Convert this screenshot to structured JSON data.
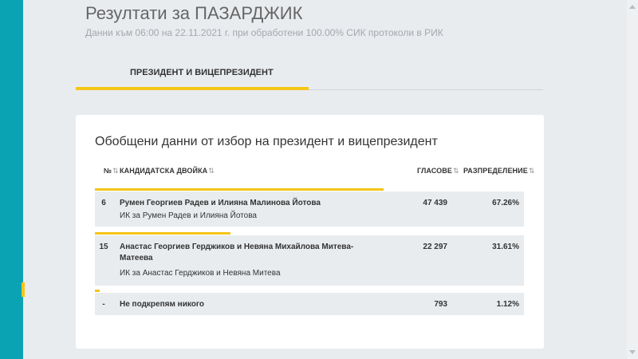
{
  "header": {
    "title": "Резултати за ПАЗАРДЖИК",
    "subtitle": "Данни към 06:00 на 22.11.2021 г. при обработени 100.00% СИК протоколи в РИК"
  },
  "tabs": [
    {
      "label": "ПРЕЗИДЕНТ И ВИЦЕПРЕЗИДЕНТ",
      "active": true
    }
  ],
  "card": {
    "title": "Обобщени данни от избор на президент и вицепрезидент",
    "columns": {
      "number": "№",
      "pair": "КАНДИДАТСКА ДВОЙКА",
      "votes": "ГЛАСОВЕ",
      "share": "РАЗПРЕДЕЛЕНИЕ"
    },
    "rows": [
      {
        "number": "6",
        "name": "Румен Георгиев Радев и Илияна Малинова Йотова",
        "committee": "ИК за Румен Радев и Илияна Йотова",
        "votes": "47 439",
        "share": "67.26%",
        "share_value": 67.26
      },
      {
        "number": "15",
        "name": "Анастас Георгиев Герджиков и Невяна Михайлова Митева-Матеева",
        "committee": "ИК за Анастас Герджиков и Невяна Митева",
        "votes": "22 297",
        "share": "31.61%",
        "share_value": 31.61
      },
      {
        "number": "-",
        "name": "Не подкрепям никого",
        "committee": "",
        "votes": "793",
        "share": "1.12%",
        "share_value": 1.12
      }
    ]
  },
  "colors": {
    "accent_teal": "#0aa3b4",
    "accent_yellow": "#f5c518",
    "background": "#e9ecef"
  },
  "icons": {
    "sort": "sort-arrows-icon"
  }
}
